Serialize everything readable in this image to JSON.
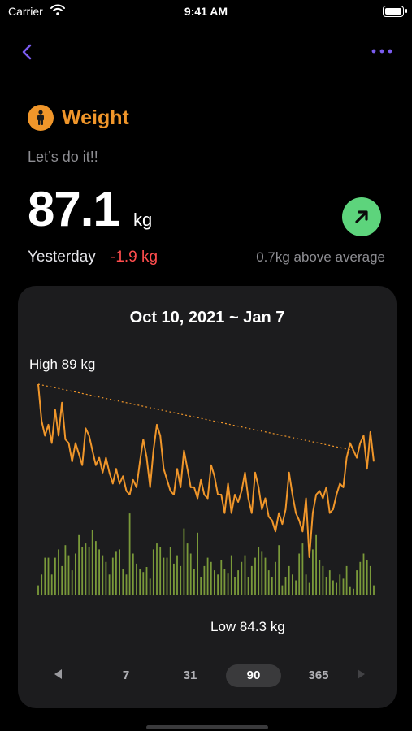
{
  "status_bar": {
    "carrier": "Carrier",
    "time": "9:41 AM"
  },
  "header": {
    "title": "Weight",
    "motto": "Let’s do it!!"
  },
  "summary": {
    "value": "87.1",
    "unit": "kg",
    "yesterday_label": "Yesterday",
    "yesterday_delta": "-1.9 kg",
    "average_note": "0.7kg above average",
    "trend": "up"
  },
  "chart": {
    "date_range": "Oct 10, 2021 ~ Jan 7",
    "high_label": "High 89 kg",
    "low_label": "Low 84.3 kg"
  },
  "chart_data": {
    "type": "line",
    "title": "Oct 10, 2021 ~ Jan 7",
    "ylim": [
      84.3,
      89
    ],
    "series": [
      {
        "values": [
          89.0,
          88.0,
          87.6,
          87.9,
          87.4,
          88.3,
          87.6,
          88.5,
          87.5,
          87.4,
          86.9,
          87.4,
          87.1,
          86.8,
          87.8,
          87.6,
          87.2,
          86.8,
          87.0,
          86.6,
          87.0,
          86.6,
          86.3,
          86.7,
          86.3,
          86.5,
          86.1,
          86.0,
          86.4,
          86.2,
          86.9,
          87.5,
          87.0,
          86.2,
          87.2,
          87.9,
          87.6,
          86.7,
          86.4,
          86.1,
          86.0,
          86.7,
          86.2,
          87.2,
          86.7,
          86.2,
          86.2,
          85.9,
          86.4,
          86.0,
          85.9,
          86.8,
          86.5,
          86.0,
          86.0,
          85.5,
          86.3,
          85.5,
          86.0,
          85.8,
          86.1,
          86.6,
          85.9,
          85.5,
          86.6,
          86.2,
          85.6,
          85.9,
          85.4,
          85.3,
          85.0,
          85.5,
          85.2,
          85.6,
          86.6,
          86.0,
          85.5,
          85.3,
          85.0,
          85.9,
          84.3,
          85.5,
          86.0,
          86.1,
          85.9,
          86.2,
          85.5,
          85.6,
          86.0,
          86.3,
          86.2,
          87.0,
          87.4,
          87.2,
          87.0,
          87.4,
          87.6,
          86.7,
          87.7,
          86.9
        ]
      },
      {
        "values": [
          0.12,
          0.25,
          0.45,
          0.45,
          0.25,
          0.45,
          0.55,
          0.35,
          0.6,
          0.48,
          0.3,
          0.5,
          0.72,
          0.58,
          0.62,
          0.58,
          0.78,
          0.65,
          0.55,
          0.48,
          0.4,
          0.25,
          0.45,
          0.52,
          0.55,
          0.32,
          0.25,
          0.98,
          0.5,
          0.38,
          0.32,
          0.28,
          0.34,
          0.2,
          0.55,
          0.62,
          0.58,
          0.45,
          0.45,
          0.58,
          0.38,
          0.48,
          0.35,
          0.8,
          0.62,
          0.5,
          0.32,
          0.75,
          0.22,
          0.35,
          0.45,
          0.4,
          0.3,
          0.25,
          0.42,
          0.32,
          0.26,
          0.48,
          0.22,
          0.3,
          0.4,
          0.48,
          0.22,
          0.35,
          0.45,
          0.58,
          0.52,
          0.45,
          0.3,
          0.22,
          0.4,
          0.6,
          0.12,
          0.22,
          0.35,
          0.25,
          0.18,
          0.5,
          0.62,
          0.25,
          0.15,
          0.55,
          0.72,
          0.42,
          0.35,
          0.22,
          0.3,
          0.18,
          0.15,
          0.25,
          0.2,
          0.35,
          0.1,
          0.08,
          0.3,
          0.4,
          0.5,
          0.42,
          0.35,
          0.12
        ]
      }
    ]
  },
  "period_selector": {
    "options": [
      "7",
      "31",
      "90",
      "365"
    ],
    "selected": "90"
  },
  "colors": {
    "accent": "#f0962a",
    "trend_badge": "#5dd47c",
    "negative": "#ff4d4d",
    "bar": "#7a9a3a",
    "card": "#1c1c1e"
  }
}
